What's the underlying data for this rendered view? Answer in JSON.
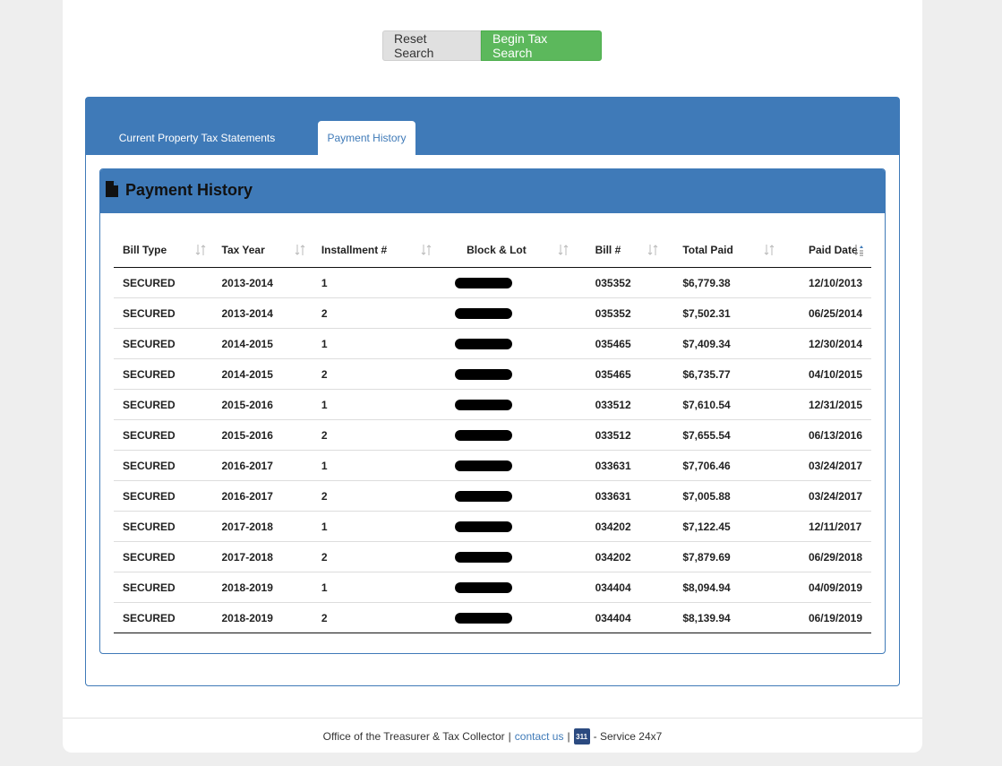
{
  "buttons": {
    "reset_label": "Reset Search",
    "search_label": "Begin Tax Search"
  },
  "tabs": [
    {
      "label": "Current Property Tax Statements",
      "active": false
    },
    {
      "label": "Payment History",
      "active": true
    }
  ],
  "panel": {
    "title": "Payment History"
  },
  "table": {
    "headers": [
      "Bill Type",
      "Tax Year",
      "Installment #",
      "Block & Lot",
      "Bill #",
      "Total Paid",
      "Paid Date"
    ],
    "rows": [
      [
        "SECURED",
        "2013-2014",
        "1",
        "",
        "035352",
        "$6,779.38",
        "12/10/2013"
      ],
      [
        "SECURED",
        "2013-2014",
        "2",
        "",
        "035352",
        "$7,502.31",
        "06/25/2014"
      ],
      [
        "SECURED",
        "2014-2015",
        "1",
        "",
        "035465",
        "$7,409.34",
        "12/30/2014"
      ],
      [
        "SECURED",
        "2014-2015",
        "2",
        "",
        "035465",
        "$6,735.77",
        "04/10/2015"
      ],
      [
        "SECURED",
        "2015-2016",
        "1",
        "",
        "033512",
        "$7,610.54",
        "12/31/2015"
      ],
      [
        "SECURED",
        "2015-2016",
        "2",
        "",
        "033512",
        "$7,655.54",
        "06/13/2016"
      ],
      [
        "SECURED",
        "2016-2017",
        "1",
        "",
        "033631",
        "$7,706.46",
        "03/24/2017"
      ],
      [
        "SECURED",
        "2016-2017",
        "2",
        "",
        "033631",
        "$7,005.88",
        "03/24/2017"
      ],
      [
        "SECURED",
        "2017-2018",
        "1",
        "",
        "034202",
        "$7,122.45",
        "12/11/2017"
      ],
      [
        "SECURED",
        "2017-2018",
        "2",
        "",
        "034202",
        "$7,879.69",
        "06/29/2018"
      ],
      [
        "SECURED",
        "2018-2019",
        "1",
        "",
        "034404",
        "$8,094.94",
        "04/09/2019"
      ],
      [
        "SECURED",
        "2018-2019",
        "2",
        "",
        "034404",
        "$8,139.94",
        "06/19/2019"
      ]
    ]
  },
  "footer": {
    "office": "Office of the Treasurer & Tax Collector",
    "sep1": "|",
    "contact": "contact us",
    "sep2": "|",
    "badge": "311",
    "service": "- Service 24x7"
  },
  "colors": {
    "primary": "#3f7ab8",
    "success": "#5cb85c"
  },
  "icons": {
    "sort": "sort-icon",
    "sort_active": "sort-active-icon",
    "document": "document-icon"
  }
}
